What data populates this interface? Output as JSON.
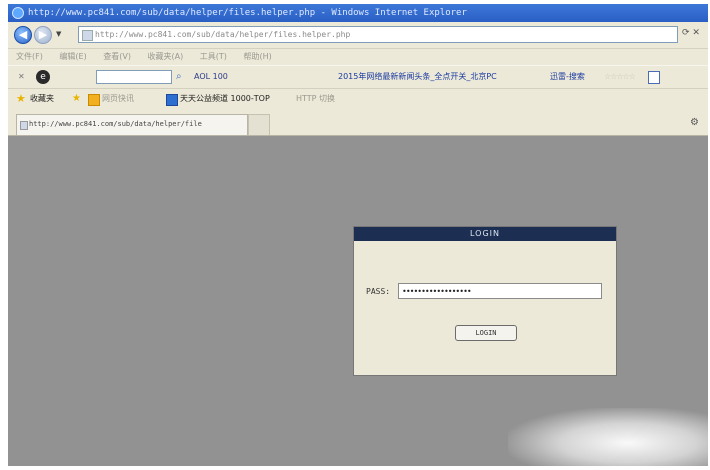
{
  "window": {
    "title": "http://www.pc841.com/sub/data/helper/files.helper.php - Windows Internet Explorer"
  },
  "address_bar": {
    "url": "http://www.pc841.com/sub/data/helper/files.helper.php"
  },
  "menu": {
    "items": [
      "文件(F)",
      "编辑(E)",
      "查看(V)",
      "收藏夹(A)",
      "工具(T)",
      "帮助(H)"
    ]
  },
  "toolbar": {
    "rating_text": "AOL 100",
    "hot_news": "2015年网络最新新闻头条_全点开关_北京PC",
    "user_label": "迅雷-搜索"
  },
  "favorites": {
    "label": "收藏夹",
    "gallery": "网页快讯",
    "link": "天天公益频道 1000-TOP",
    "web": "HTTP 切换"
  },
  "tabs": [
    {
      "label": "http://www.pc841.com/sub/data/helper/file"
    }
  ],
  "login": {
    "header": "LOGIN",
    "pass_label": "PASS:",
    "pass_value": "••••••••••••••••••",
    "button_label": "LOGIN"
  }
}
